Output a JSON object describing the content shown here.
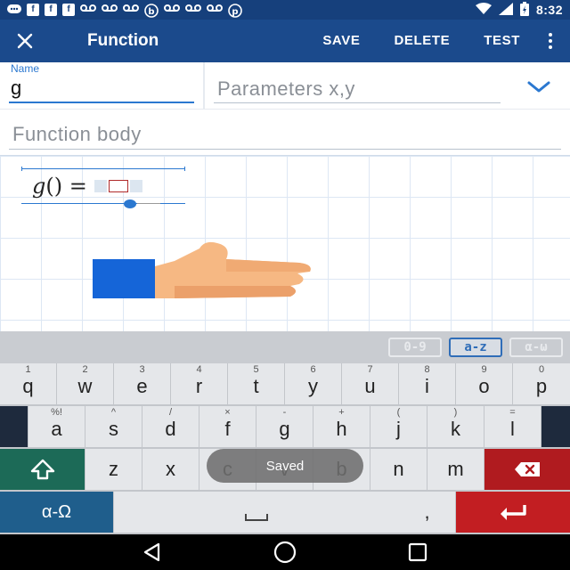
{
  "status": {
    "left_icons": [
      "chat-icon",
      "facebook-icon",
      "facebook-icon",
      "facebook-icon",
      "voicemail-icon",
      "voicemail-icon",
      "voicemail-icon",
      "b-icon",
      "voicemail-icon",
      "voicemail-icon",
      "voicemail-icon",
      "pinterest-icon"
    ],
    "time": "8:32"
  },
  "appbar": {
    "title": "Function",
    "save": "SAVE",
    "delete": "DELETE",
    "test": "TEST",
    "bg": "#1b4a8c"
  },
  "form": {
    "name_label": "Name",
    "name_value": "g",
    "params_placeholder": "Parameters x,y",
    "body_placeholder": "Function body"
  },
  "formula": {
    "fname": "g",
    "parens": "()",
    "equals": " ="
  },
  "keyboard": {
    "modes": [
      "0-9",
      "a-z",
      "α-ω"
    ],
    "active_mode": "a-z",
    "row1": [
      {
        "sup": "1",
        "key": "q"
      },
      {
        "sup": "2",
        "key": "w"
      },
      {
        "sup": "3",
        "key": "e"
      },
      {
        "sup": "4",
        "key": "r"
      },
      {
        "sup": "5",
        "key": "t"
      },
      {
        "sup": "6",
        "key": "y"
      },
      {
        "sup": "7",
        "key": "u"
      },
      {
        "sup": "8",
        "key": "i"
      },
      {
        "sup": "9",
        "key": "o"
      },
      {
        "sup": "0",
        "key": "p"
      }
    ],
    "row2": [
      {
        "sup": "%!",
        "key": "a"
      },
      {
        "sup": "^",
        "key": "s"
      },
      {
        "sup": "/",
        "key": "d"
      },
      {
        "sup": "×",
        "key": "f"
      },
      {
        "sup": "-",
        "key": "g"
      },
      {
        "sup": "+",
        "key": "h"
      },
      {
        "sup": "(",
        "key": "j"
      },
      {
        "sup": ")",
        "key": "k"
      },
      {
        "sup": "=",
        "key": "l"
      }
    ],
    "row3": [
      "z",
      "x",
      "c",
      "v",
      "b",
      "n",
      "m"
    ],
    "greek_label": "α-Ω",
    "comma": ",",
    "toast": "Saved"
  }
}
